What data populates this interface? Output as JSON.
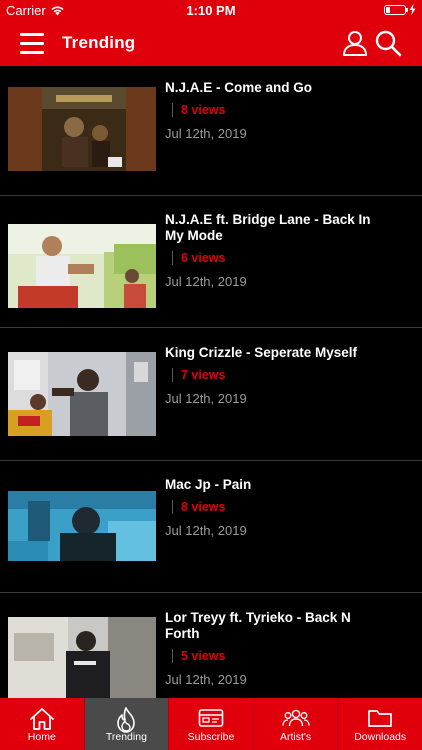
{
  "status_bar": {
    "carrier": "Carrier",
    "time": "1:10 PM",
    "battery_level": 0.2
  },
  "header": {
    "title": "Trending",
    "left_icon": "menu-icon",
    "right_icons": [
      "user-icon",
      "search-icon"
    ]
  },
  "videos": [
    {
      "title": "N.J.A.E - Come and Go",
      "views": "8 views",
      "date": "Jul 12th, 2019"
    },
    {
      "title": "N.J.A.E ft. Bridge Lane - Back In My Mode",
      "views": "6 views",
      "date": "Jul 12th, 2019"
    },
    {
      "title": "King Crizzle - Seperate Myself",
      "views": "7 views",
      "date": "Jul 12th, 2019"
    },
    {
      "title": "Mac Jp - Pain",
      "views": "8 views",
      "date": "Jul 12th, 2019"
    },
    {
      "title": "Lor Treyy ft. Tyrieko - Back N Forth",
      "views": "5 views",
      "date": "Jul 12th, 2019"
    }
  ],
  "tabs": [
    {
      "label": "Home",
      "icon": "home-icon",
      "active": false
    },
    {
      "label": "Trending",
      "icon": "flame-icon",
      "active": true
    },
    {
      "label": "Subscribe",
      "icon": "ticket-icon",
      "active": false
    },
    {
      "label": "Artist's",
      "icon": "group-icon",
      "active": false
    },
    {
      "label": "Downloads",
      "icon": "folder-icon",
      "active": false
    }
  ],
  "colors": {
    "brand_red": "#e0000b",
    "background": "#000000",
    "active_tab": "#4a4a4a",
    "date_gray": "#9a9a9a"
  }
}
